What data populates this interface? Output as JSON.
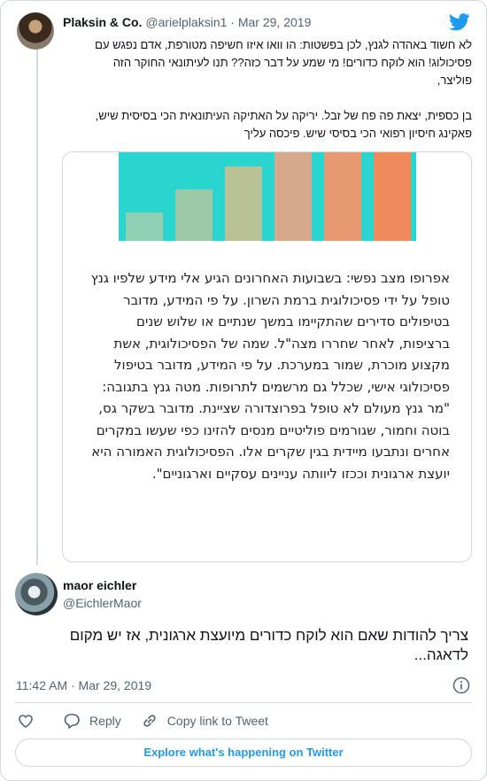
{
  "quoted_tweet": {
    "author_name": "Plaksin & Co.",
    "handle": "@arielplaksin1",
    "separator": "·",
    "date": "Mar 29, 2019",
    "text_lines": [
      "לא חשוד באהדה לגנץ, לכן בפשטות: הו וואו איזו חשיפה מטורפת, אדם נפגש עם",
      "פסיכולוג! הוא לוקח כדורים! מי שמע על דבר כזה?? תנו לעיתונאי החוקר הזה",
      "פוליצר,"
    ],
    "text_lines_2": [
      "בן כספית, יצאת פה פח של זבל. יריקה על האתיקה העיתונאית הכי בסיסית שיש,",
      "פאקינג חיסיון רפואי הכי בסיסי שיש. פיכסה עליך"
    ],
    "media": {
      "paragraph": "אפרופו מצב נפשי: בשבועות האחרונים הגיע אלי מידע שלפיו גנץ טופל על ידי פסיכולוגית ברמת השרון. על פי המידע, מדובר בטיפולים סדירים שהתקיימו במשך שנתיים או שלוש שנים ברציפות, לאחר שחררו מצה\"ל. שמה של הפסיכולוגית, אשת מקצוע מוכרת, שמור במערכת. על פי המידע, מדובר בטיפול פסיכולוגי אישי, שכלל גם מרשמים לתרופות. מטה גנץ בתגובה: \"מר גנץ מעולם לא טופל בפרוצדורה שציינת. מדובר בשקר גס, בוטה וחמור, שגורמים פוליטיים מנסים להזינו כפי שעשו במקרים אחרים ונתבעו מיידית בגין שקרים אלו. הפסיכולוגית האמורה היא יועצת ארגונית וככזו ליוותה עניינים עסקיים וארגוניים\"."
    }
  },
  "main_tweet": {
    "author_name": "maor eichler",
    "handle": "@EichlerMaor",
    "text": "צריך להודות שאם הוא לוקח כדורים מיועצת ארגונית, אז יש מקום לדאגה...",
    "timestamp": "11:42 AM · Mar 29, 2019"
  },
  "actions": {
    "reply": "Reply",
    "copy_link": "Copy link to Tweet"
  },
  "explore_button": "Explore what's happening on Twitter",
  "colors": {
    "accent": "#1d9bf0",
    "secondary_text": "#536471",
    "border": "#cfd9de",
    "chart_bg": "#2bd5cf"
  }
}
